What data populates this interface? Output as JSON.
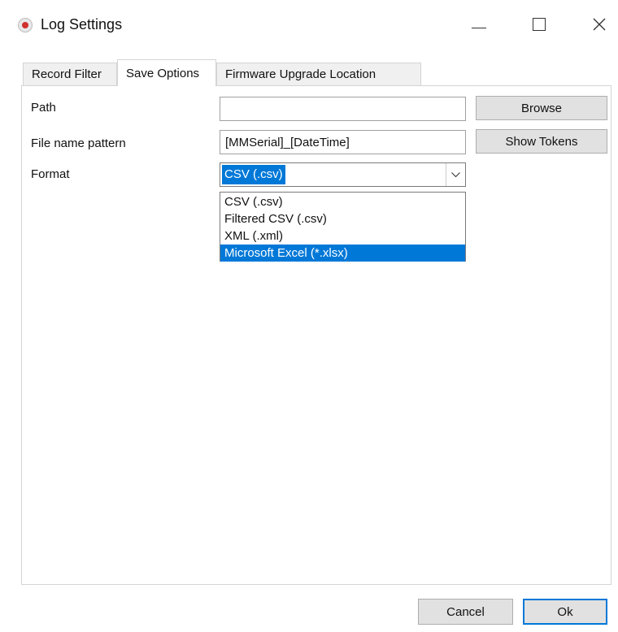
{
  "window": {
    "title": "Log Settings",
    "icon": "app-logo-icon"
  },
  "tabs": [
    {
      "label": "Record Filter",
      "active": false
    },
    {
      "label": "Save Options",
      "active": true
    },
    {
      "label": "Firmware Upgrade Location",
      "active": false
    }
  ],
  "form": {
    "path_label": "Path",
    "path_value": "",
    "browse_label": "Browse",
    "pattern_label": "File name pattern",
    "pattern_value": "[MMSerial]_[DateTime]",
    "show_tokens_label": "Show Tokens",
    "format_label": "Format",
    "format_selected": "CSV (.csv)",
    "format_options": [
      "CSV (.csv)",
      "Filtered CSV (.csv)",
      "XML (.xml)",
      "Microsoft Excel (*.xlsx)"
    ],
    "format_highlighted_index": 3
  },
  "footer": {
    "cancel_label": "Cancel",
    "ok_label": "Ok"
  },
  "colors": {
    "accent": "#0078d7",
    "button_face": "#e1e1e1"
  }
}
